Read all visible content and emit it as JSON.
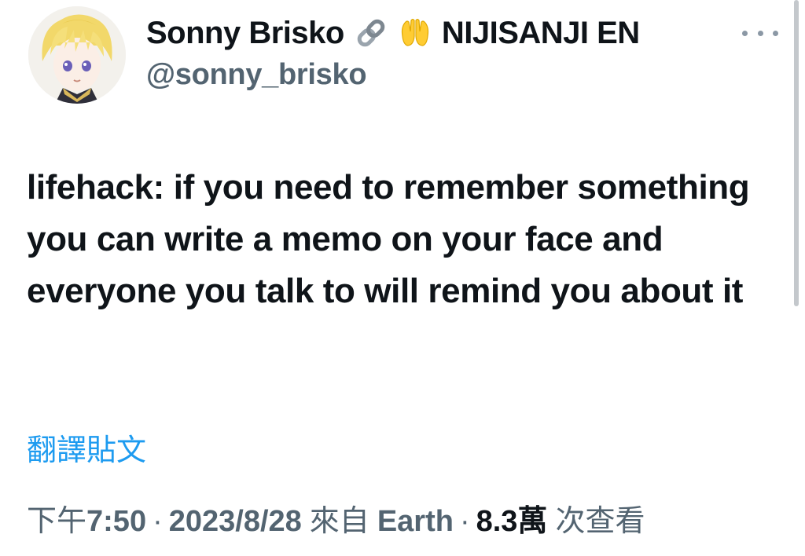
{
  "author": {
    "display_name": "Sonny Brisko",
    "name_icons": [
      "link-icon",
      "raising-hands-icon"
    ],
    "name_suffix": "NIJISANJI EN",
    "handle": "@sonny_brisko"
  },
  "tweet": {
    "text": "lifehack: if you need to remember something you can write a memo on your face and everyone you talk to will remind you about it",
    "translate_label": "翻譯貼文"
  },
  "meta": {
    "time_prefix": "下午",
    "time": "7:50",
    "separator": "·",
    "date": "2023/8/28",
    "source_prefix": "來自",
    "source": "Earth",
    "views_count": "8.3萬",
    "views_label": "次查看"
  },
  "colors": {
    "link": "#1d9bf0",
    "secondary_text": "#536471",
    "primary_text": "#0f1419"
  }
}
